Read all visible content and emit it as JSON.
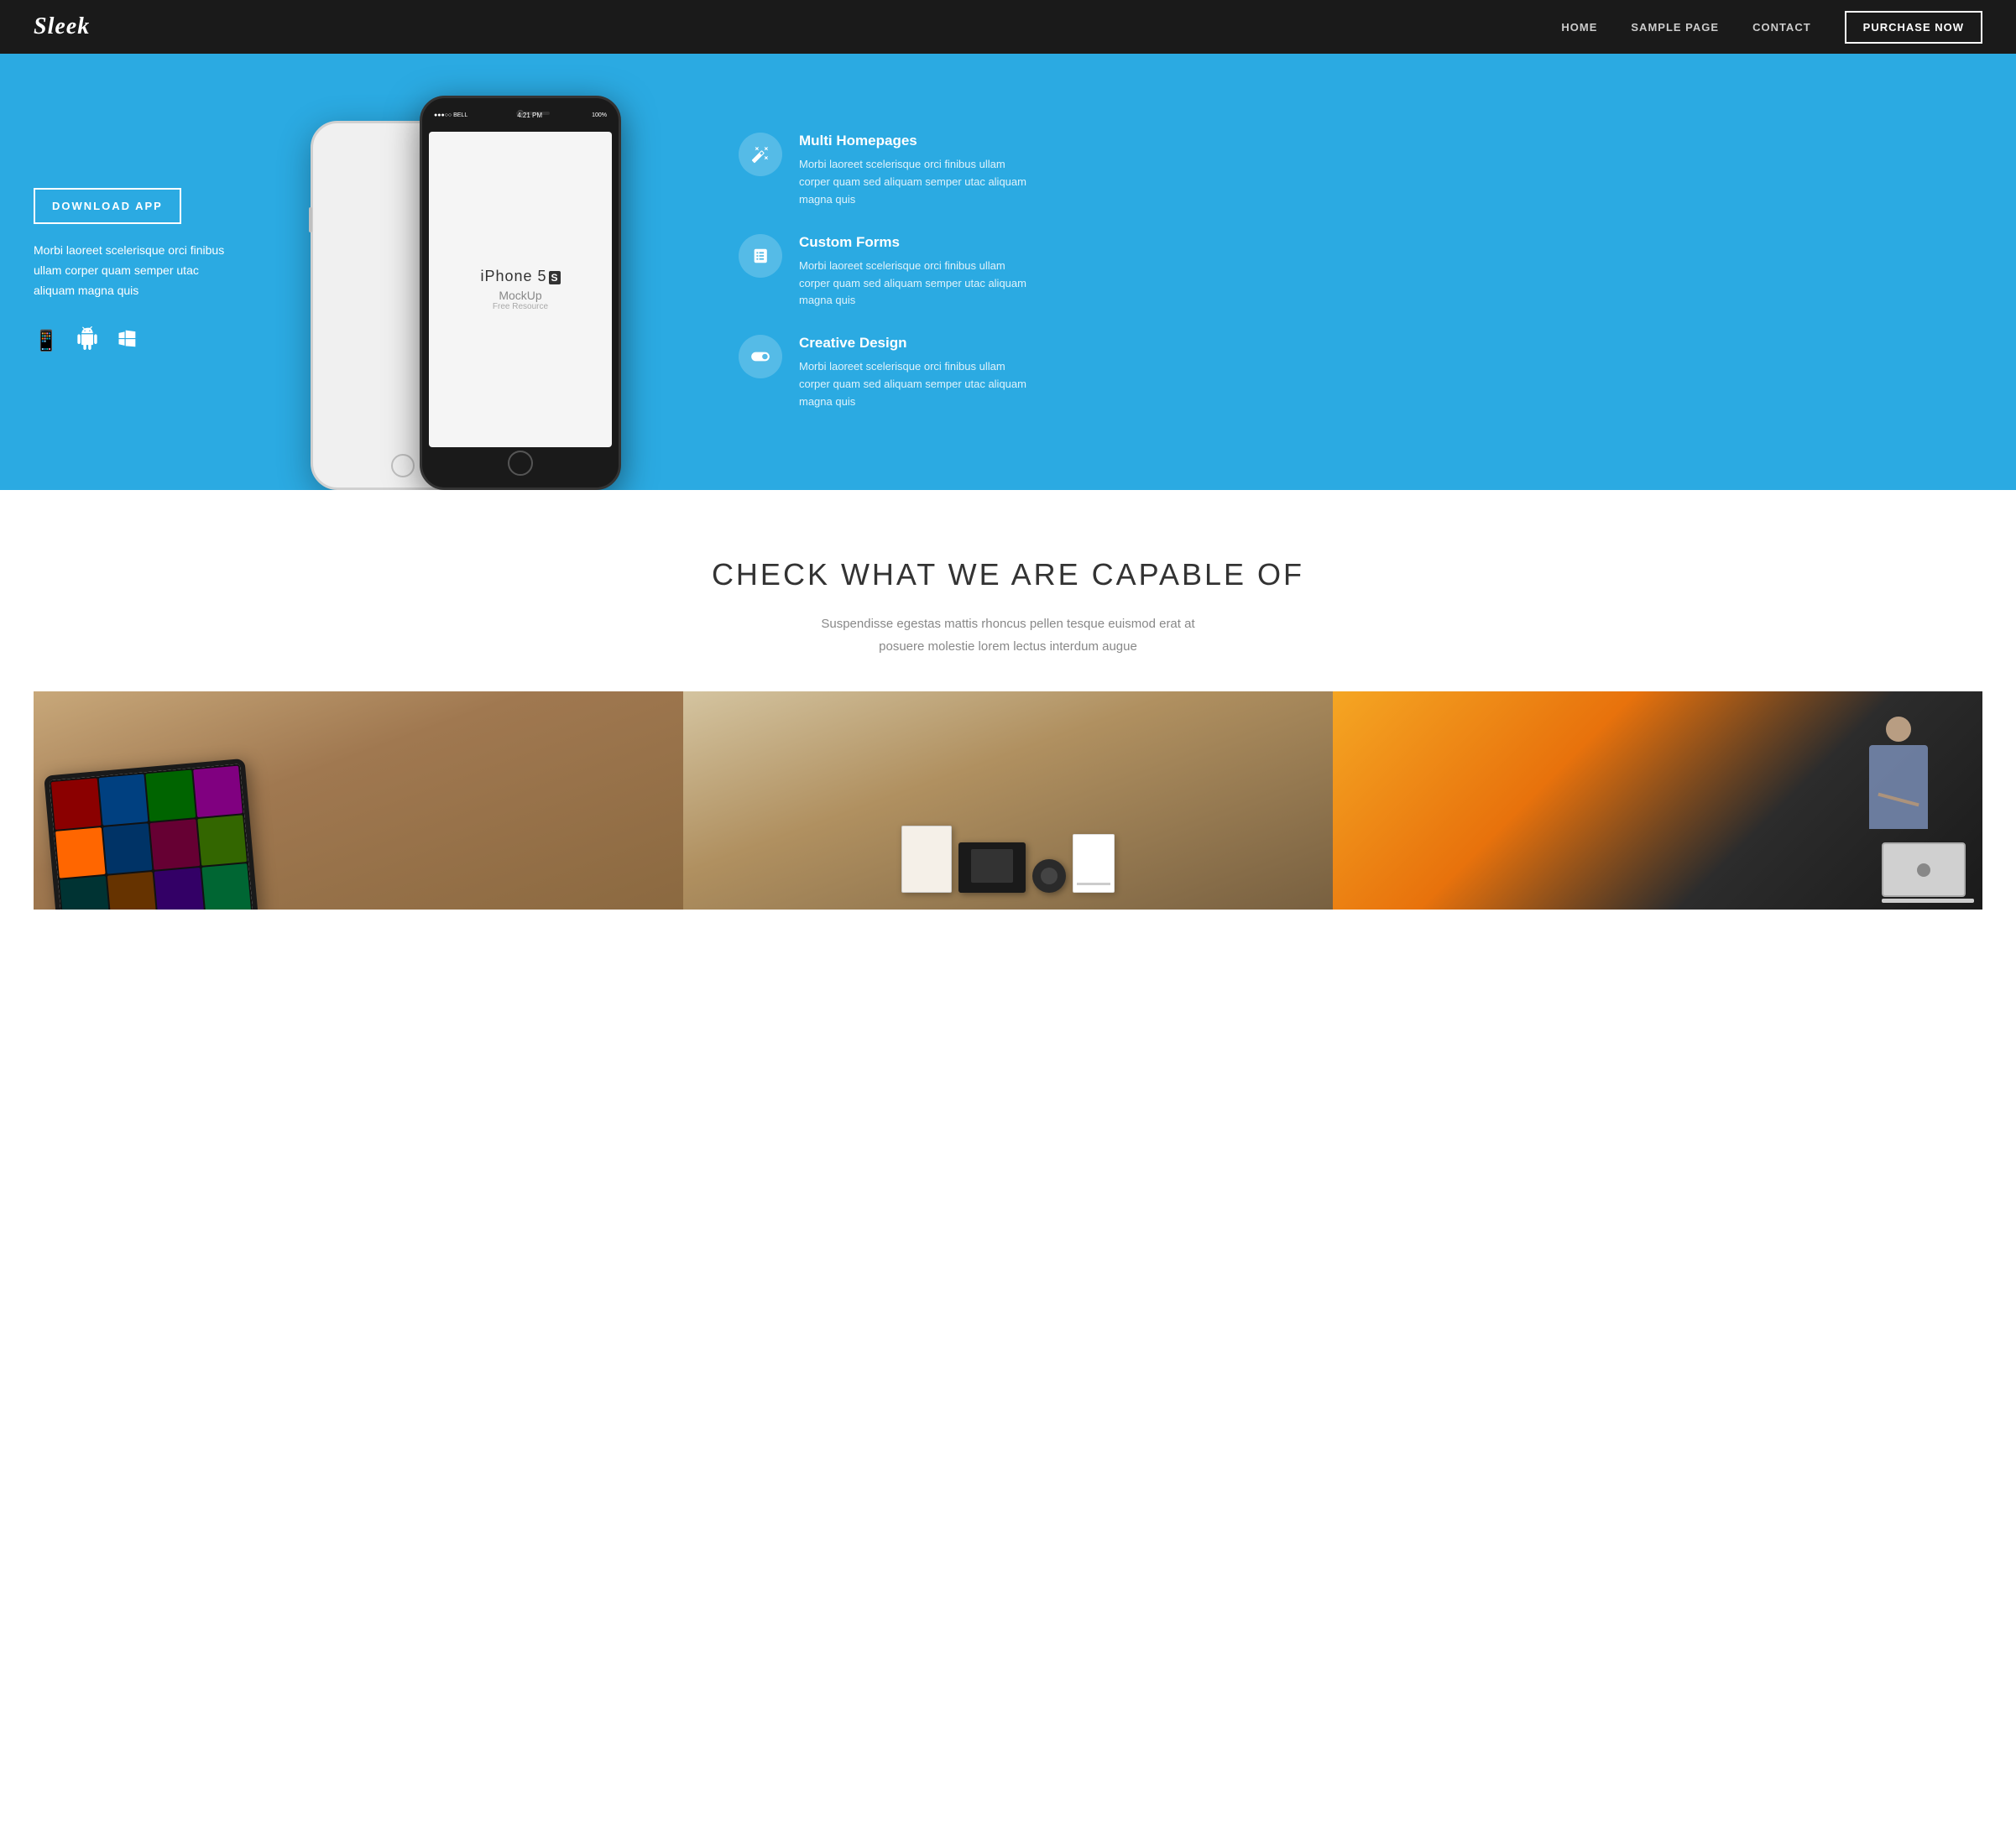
{
  "brand": {
    "logo": "Sleek"
  },
  "nav": {
    "links": [
      {
        "label": "HOME",
        "href": "#"
      },
      {
        "label": "SAMPLE PAGE",
        "href": "#"
      },
      {
        "label": "CONTACT",
        "href": "#"
      }
    ],
    "purchase_label": "PURCHASE NOW"
  },
  "hero": {
    "download_btn": "DOWNLOAD APP",
    "description": "Morbi laoreet scelerisque orci finibus ullam corper quam semper utac aliquam magna quis",
    "icons": [
      "phone-icon",
      "android-icon",
      "windows-icon"
    ],
    "features": [
      {
        "icon": "magic-icon",
        "title": "Multi Homepages",
        "description": "Morbi laoreet scelerisque orci finibus ullam corper quam sed aliquam semper utac aliquam magna quis"
      },
      {
        "icon": "tablet-icon",
        "title": "Custom Forms",
        "description": "Morbi laoreet scelerisque orci finibus ullam corper quam sed aliquam semper utac aliquam magna quis"
      },
      {
        "icon": "toggle-icon",
        "title": "Creative Design",
        "description": "Morbi laoreet scelerisque orci finibus ullam corper quam sed aliquam semper utac aliquam magna quis"
      }
    ],
    "phone_model": "iPhone 5",
    "phone_model_suffix": "S",
    "phone_mockup_label": "MockUp",
    "phone_free_resource": "Free Resource"
  },
  "capabilities": {
    "title": "CHECK WHAT WE ARE CAPABLE OF",
    "subtitle_line1": "Suspendisse egestas mattis rhoncus pellen tesque euismod erat at",
    "subtitle_line2": "posuere molestie lorem lectus interdum augue"
  },
  "portfolio": {
    "items": [
      {
        "type": "ipad",
        "alt": "iPad with app thumbnails"
      },
      {
        "type": "stationery",
        "alt": "Stationery and branding items"
      },
      {
        "type": "laptop-person",
        "alt": "Person working on laptop"
      }
    ]
  },
  "colors": {
    "hero_bg": "#2baae2",
    "nav_bg": "#1a1a1a",
    "accent": "#2baae2"
  },
  "status_bar": {
    "carrier": "●●●○○ BELL",
    "wifi": "▲",
    "time": "4:21 PM",
    "bluetooth": "✱",
    "battery": "100%"
  }
}
